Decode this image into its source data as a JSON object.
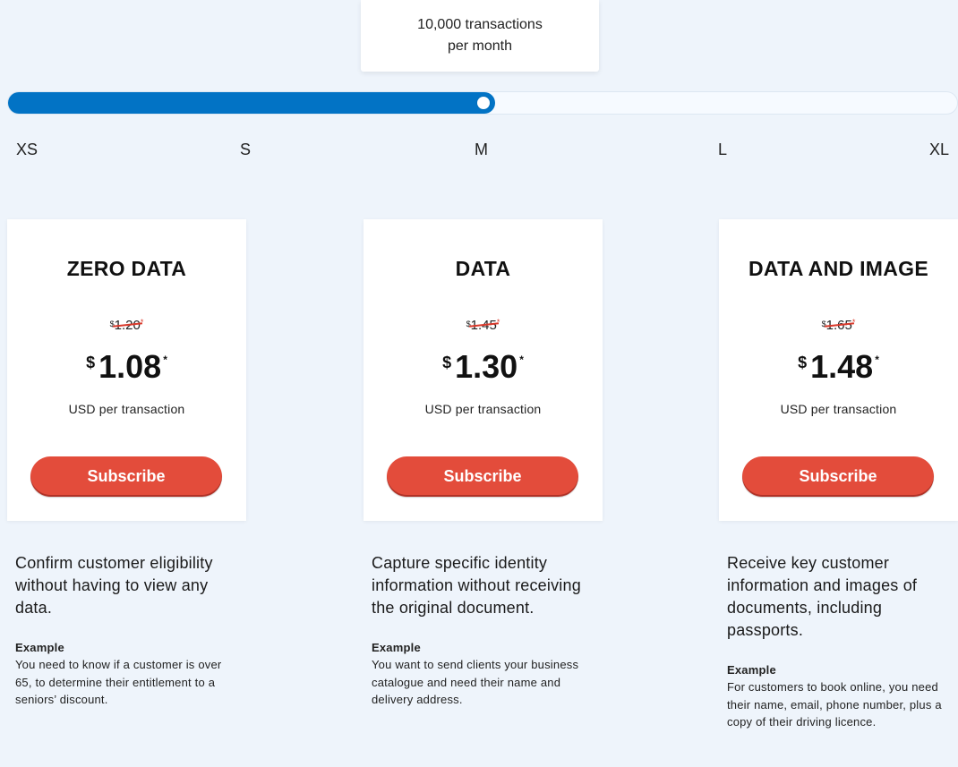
{
  "slider": {
    "tooltip_line1": "10,000 transactions",
    "tooltip_line2": "per month",
    "value_fraction": 0.5,
    "fill_color": "#0273c5",
    "ticks": [
      "XS",
      "S",
      "M",
      "L",
      "XL"
    ],
    "selected": "M"
  },
  "plans": [
    {
      "title": "ZERO DATA",
      "currency": "$",
      "old_price": "1.20",
      "new_price": "1.08",
      "asterisk": "*",
      "unit": "USD per transaction",
      "button": "Subscribe",
      "description": "Confirm customer eligibility without having to view any data.",
      "example_label": "Example",
      "example_text": "You need to know if a customer is over 65, to determine their entitlement to a seniors’ discount."
    },
    {
      "title": "DATA",
      "currency": "$",
      "old_price": "1.45",
      "new_price": "1.30",
      "asterisk": "*",
      "unit": "USD per transaction",
      "button": "Subscribe",
      "description": "Capture specific identity information without receiving the original document.",
      "example_label": "Example",
      "example_text": "You want to send clients your business catalogue and need their name and delivery address."
    },
    {
      "title": "DATA AND IMAGE",
      "currency": "$",
      "old_price": "1.65",
      "new_price": "1.48",
      "asterisk": "*",
      "unit": "USD per transaction",
      "button": "Subscribe",
      "description": "Receive key customer information and images of documents, including passports.",
      "example_label": "Example",
      "example_text": "For customers to book online, you need their name, email, phone number, plus a copy of their driving licence."
    }
  ],
  "colors": {
    "background": "#eef4fb",
    "button": "#e34c3b",
    "strike": "#d9392b"
  }
}
